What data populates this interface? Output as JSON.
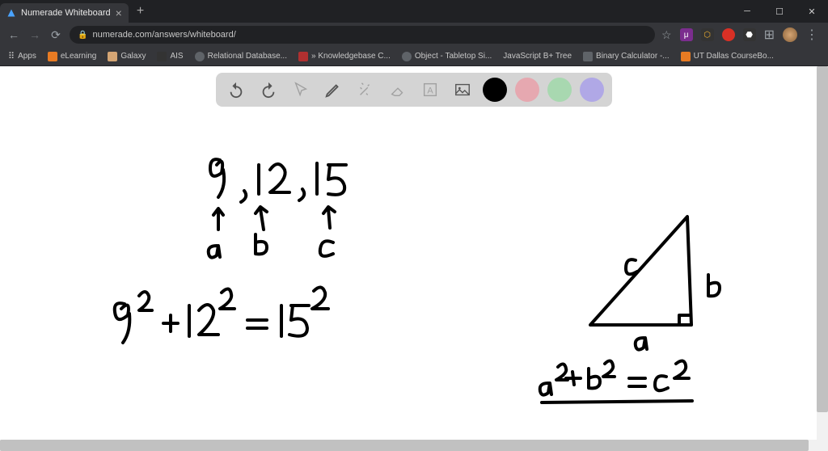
{
  "browser": {
    "tab_title": "Numerade Whiteboard",
    "url": "numerade.com/answers/whiteboard/"
  },
  "bookmarks": [
    {
      "label": "Apps",
      "color": "#5f6368"
    },
    {
      "label": "eLearning",
      "color": "#e87b23"
    },
    {
      "label": "Galaxy",
      "color": "#333"
    },
    {
      "label": "AIS",
      "color": "#333"
    },
    {
      "label": "Relational Database...",
      "color": "#5f6368"
    },
    {
      "label": "» Knowledgebase C...",
      "color": "#b03030"
    },
    {
      "label": "Object - Tabletop Si...",
      "color": "#5f6368"
    },
    {
      "label": "JavaScript B+ Tree",
      "color": ""
    },
    {
      "label": "Binary Calculator -...",
      "color": "#5f6368"
    },
    {
      "label": "UT Dallas CourseBo...",
      "color": "#e87b23"
    }
  ],
  "toolbar": {
    "colors": {
      "black": "#000000",
      "pink": "#e6a8b0",
      "green": "#a8d8b0",
      "purple": "#b0a8e6"
    }
  },
  "whiteboard": {
    "numbers_list": "9 , 12 , 15",
    "label_a": "a",
    "label_b": "b",
    "label_c": "c",
    "equation_numeric": "9² + 12² = 15²",
    "triangle_label_a": "a",
    "triangle_label_b": "b",
    "triangle_label_c": "c",
    "equation_general": "a² + b² = c²"
  }
}
